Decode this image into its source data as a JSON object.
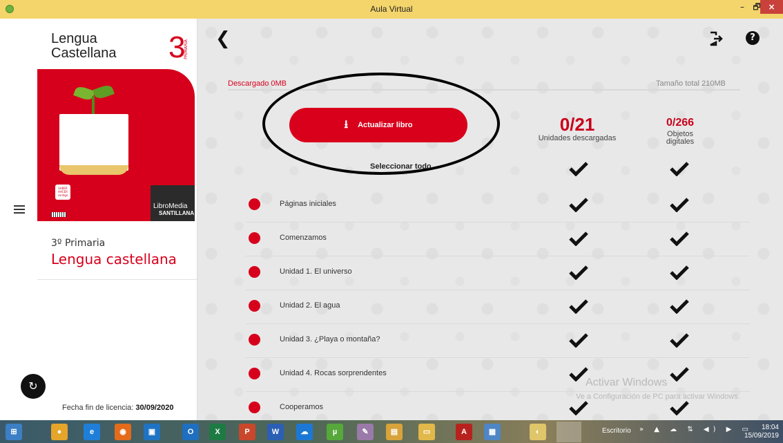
{
  "window": {
    "title": "Aula Virtual",
    "minimize": "–",
    "maximize": "🗗",
    "close": "×"
  },
  "sidebar": {
    "book_title_line1": "Lengua",
    "book_title_line2": "Castellana",
    "book_number": "3",
    "book_level_vertical": "PRIMARIA",
    "cover_saber": "SABER HACER contigo",
    "libromedia": "LibroMedia",
    "santillana": "SANTILLANA",
    "grade": "3º Primaria",
    "subject": "Lengua castellana",
    "license_label": "Fecha fin de licencia:",
    "license_date": "30/09/2020",
    "sync_icon": "↻"
  },
  "main": {
    "back_icon": "❮",
    "help_icon": "?",
    "downloaded": "Descargado 0MB",
    "total_size": "Tamaño total 210MB",
    "progress": 0,
    "update_button": "Actualizar libro",
    "units_count": "0/21",
    "units_label": "Unidades descargadas",
    "objects_count": "0/266",
    "objects_label_1": "Objetos",
    "objects_label_2": "digitales",
    "select_all": "Seleccionar todo",
    "rows": [
      {
        "label": "Páginas iniciales"
      },
      {
        "label": "Comenzamos"
      },
      {
        "label": "Unidad 1. El universo"
      },
      {
        "label": "Unidad 2. El agua"
      },
      {
        "label": "Unidad 3. ¿Playa o montaña?"
      },
      {
        "label": "Unidad 4. Rocas sorprendentes"
      },
      {
        "label": "Cooperamos"
      }
    ],
    "watermark_line1": "Activar Windows",
    "watermark_line2": "Ve a Configuración de PC para activar Windows."
  },
  "taskbar": {
    "apps": [
      "start",
      "chrome",
      "ie",
      "firefox",
      "media",
      "outlook",
      "excel",
      "powerpoint",
      "word",
      "onedrive",
      "utorrent",
      "paint",
      "files",
      "explorer",
      "acrobat",
      "control",
      "aula"
    ],
    "escritorio": "Escritorio",
    "tray": "» ▲ ☁ ⇅ ◀) ▶ ▭",
    "time": "18:04",
    "date": "15/09/2019"
  },
  "colors": {
    "accent": "#d6001c",
    "titlebar": "#f4d56b"
  }
}
